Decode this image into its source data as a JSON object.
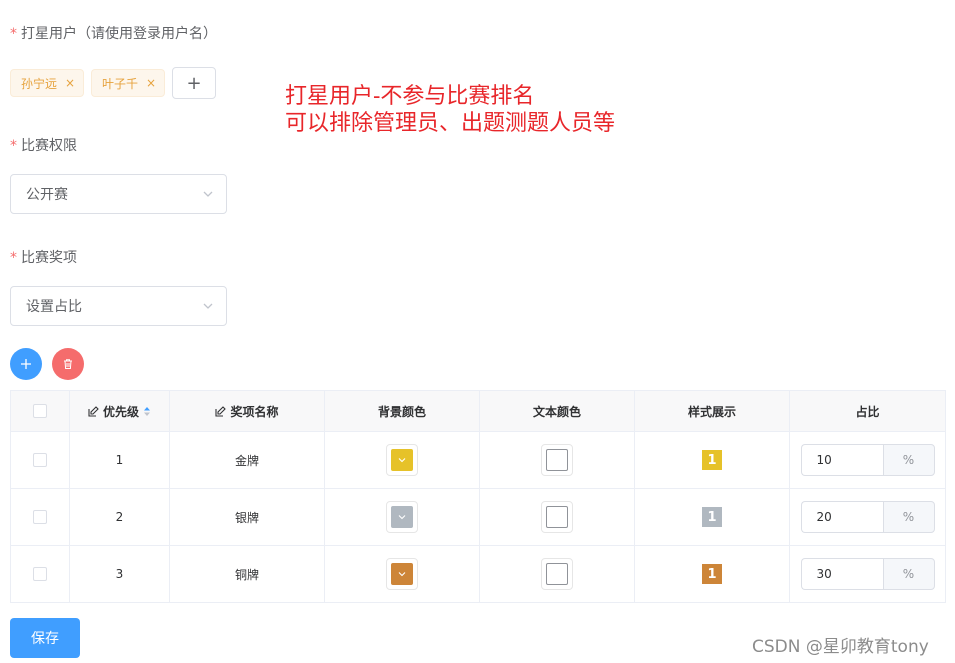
{
  "form": {
    "star_users_label": "打星用户（请使用登录用户名）",
    "required_mark": "*",
    "star_users": [
      {
        "name": "孙宁远",
        "remove": "×"
      },
      {
        "name": "叶子千",
        "remove": "×"
      }
    ],
    "add_tag_label": "+",
    "permission_label": "比赛权限",
    "permission_value": "公开赛",
    "awards_label": "比赛奖项",
    "awards_value": "设置占比"
  },
  "annotation": {
    "line1": "打星用户-不参与比赛排名",
    "line2": "可以排除管理员、出题测题人员等"
  },
  "table": {
    "headers": {
      "priority": "优先级",
      "award_name": "奖项名称",
      "bg_color": "背景颜色",
      "text_color": "文本颜色",
      "style_preview": "样式展示",
      "ratio": "占比"
    },
    "rows": [
      {
        "priority": "1",
        "name": "金牌",
        "bg": "#e6c229",
        "text_color": "#ffffff",
        "preview": "1",
        "ratio": "10",
        "unit": "%"
      },
      {
        "priority": "2",
        "name": "银牌",
        "bg": "#b0b8c0",
        "text_color": "#ffffff",
        "preview": "1",
        "ratio": "20",
        "unit": "%"
      },
      {
        "priority": "3",
        "name": "铜牌",
        "bg": "#cd8538",
        "text_color": "#ffffff",
        "preview": "1",
        "ratio": "30",
        "unit": "%"
      }
    ]
  },
  "colors": {
    "primary": "#409eff",
    "danger": "#f56c6c",
    "warning": "#e6a23c",
    "annotation": "#e8262a"
  },
  "icons": {
    "add": "plus-icon",
    "delete": "trash-icon",
    "edit": "edit-icon",
    "sort": "sort-caret-icon",
    "dropdown": "chevron-down-icon"
  },
  "save_label": "保存",
  "watermark": "CSDN @星卯教育tony"
}
